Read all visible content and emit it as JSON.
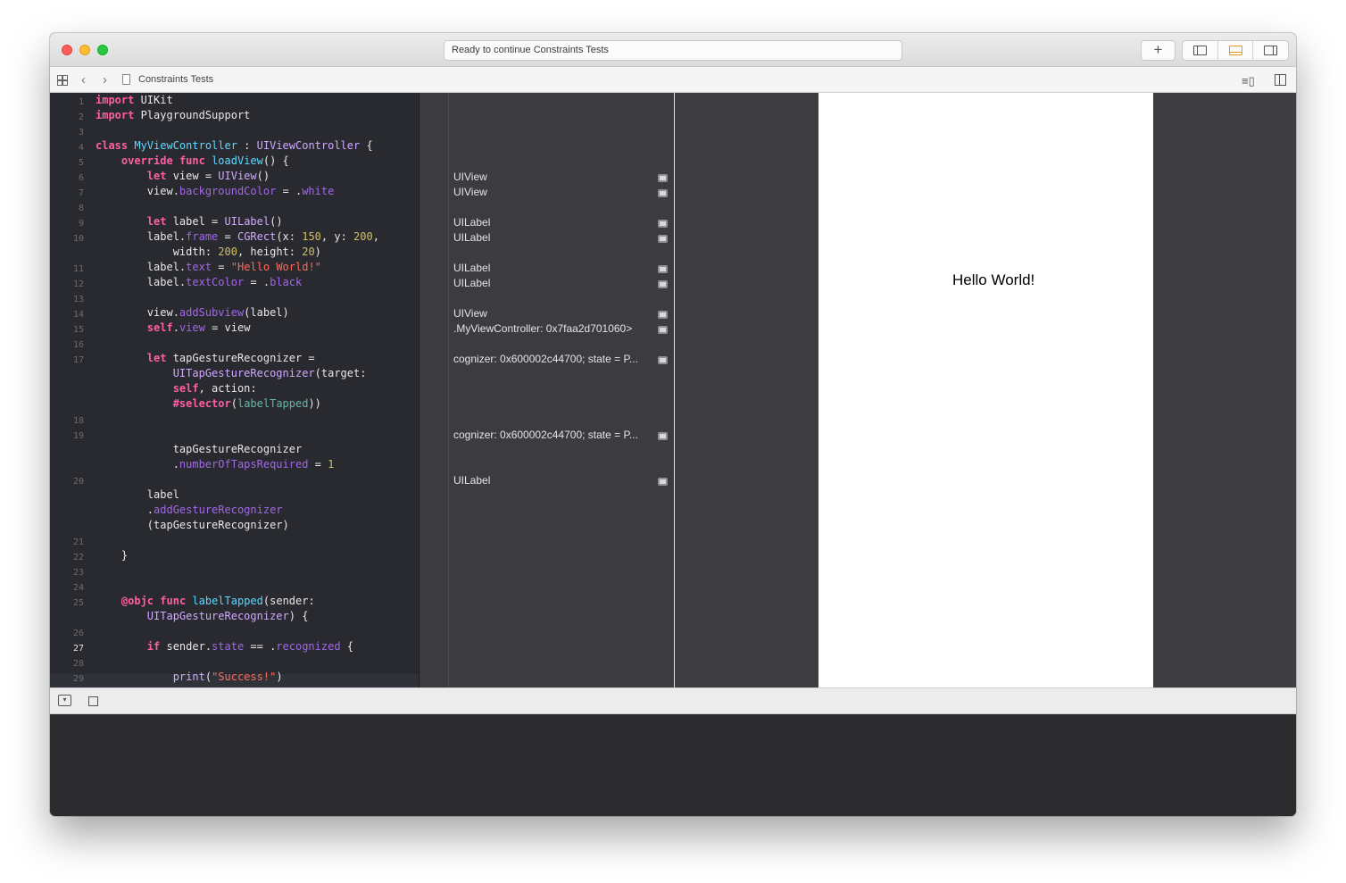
{
  "window": {
    "activity_text": "Ready to continue Constraints Tests",
    "toolbar": {
      "add_label": "+",
      "panels": [
        "navigator-toggle",
        "debug-area-toggle",
        "inspector-toggle"
      ]
    }
  },
  "jumpbar": {
    "file_title": "Constraints Tests"
  },
  "editor": {
    "line_numbers": [
      "1",
      "2",
      "3",
      "4",
      "5",
      "6",
      "7",
      "8",
      "9",
      "10",
      "11",
      "12",
      "13",
      "14",
      "15",
      "16",
      "17",
      "18",
      "19",
      "20",
      "21",
      "22",
      "23",
      "24",
      "25",
      "26",
      "27",
      "28",
      "29"
    ],
    "active_line": "27"
  },
  "results": {
    "r6": "UIView",
    "r7": "UIView",
    "r9": "UILabel",
    "r10": "UILabel",
    "r11": "UILabel",
    "r12": "UILabel",
    "r14": "UIView",
    "r15": ".MyViewController: 0x7faa2d701060>",
    "r17": "cognizer: 0x600002c44700; state = P...",
    "r19": "cognizer: 0x600002c44700; state = P...",
    "r20": "UILabel"
  },
  "live_view": {
    "label_text": "Hello World!"
  },
  "colors": {
    "editor_bg": "#292a30",
    "keyword": "#fc5fa3",
    "string": "#fc6a5d",
    "number": "#d0bf69",
    "accent": "#e59a17"
  }
}
